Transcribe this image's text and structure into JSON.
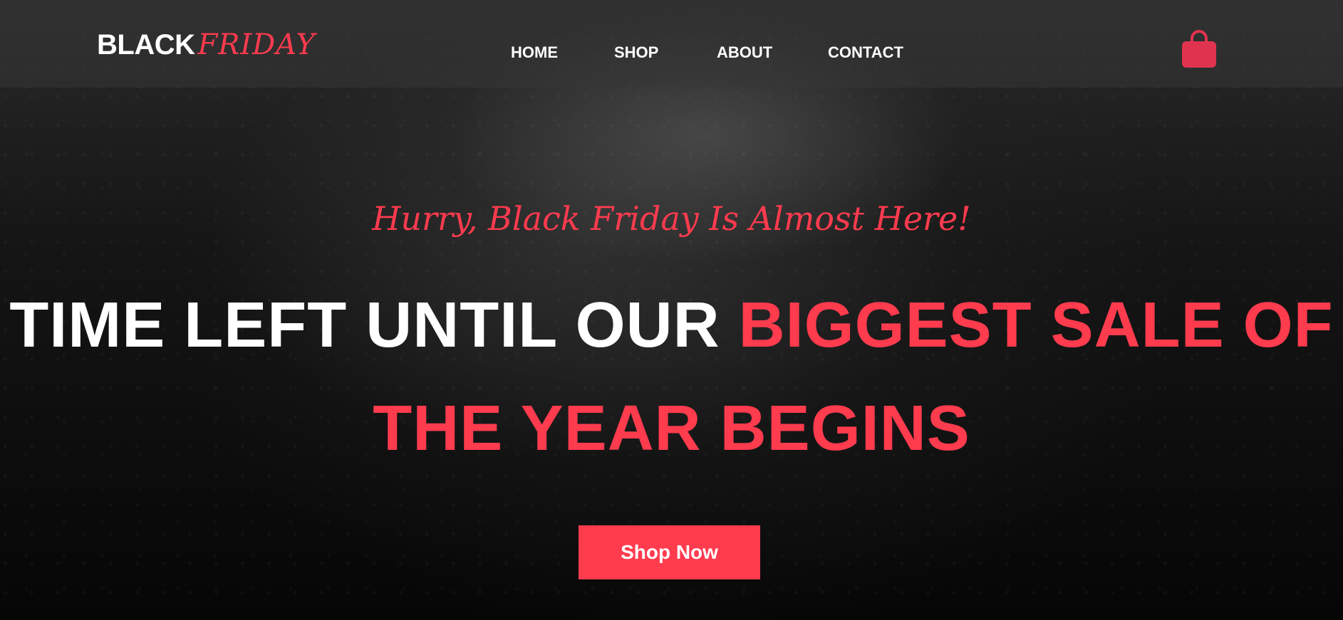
{
  "header": {
    "logo_black": "BLACK",
    "logo_friday": "FRIDAY",
    "nav": [
      {
        "label": "HOME"
      },
      {
        "label": "SHOP"
      },
      {
        "label": "ABOUT"
      },
      {
        "label": "CONTACT"
      }
    ],
    "cart_icon": "shopping-bag-icon"
  },
  "hero": {
    "subtitle": "Hurry, Black Friday Is Almost Here!",
    "title_white": "TIME LEFT UNTIL OUR ",
    "title_accent_line1": "BIGGEST SALE OF",
    "title_accent_line2": "THE YEAR BEGINS",
    "cta_label": "Shop Now"
  },
  "colors": {
    "accent": "#ff3b4e",
    "bag": "#e0334f",
    "text": "#ffffff"
  }
}
